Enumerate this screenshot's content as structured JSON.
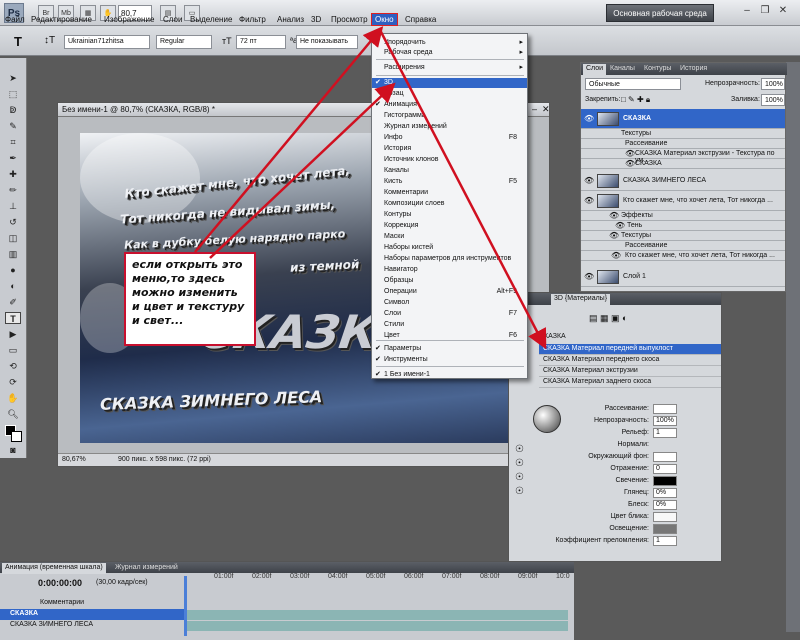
{
  "app": {
    "logo": "Ps",
    "zoom": "80,7",
    "workspace": "Основная рабочая среда"
  },
  "menu": [
    "Файл",
    "Редактирование",
    "Изображение",
    "Слои",
    "Выделение",
    "Фильтр",
    "Анализ",
    "3D",
    "Просмотр",
    "Окно",
    "Справка"
  ],
  "options": {
    "font": "Ukrainian71zhitsa",
    "style": "Regular",
    "size": "72 пт",
    "aa": "Не показывать"
  },
  "document": {
    "title": "Без имени-1 @ 80,7% (СКАЗКА, RGB/8) *",
    "zoom": "80,67%",
    "info": "900 пикс. x 598 пикс. (72 ppi)",
    "line1": "Кто скажет мне, что хочет лета,",
    "line2": "Тот никогда не видывал зимы,",
    "line3": "Как в дубку белую нарядно парко",
    "line4": "из темной",
    "title_word": "СКАЗКА",
    "bottom_word": "СКАЗКА ЗИМНЕГО ЛЕСА"
  },
  "callout": "если открыть это меню,то здесь можно изменить и цвет и текстуру и свет...",
  "window_menu": {
    "items": [
      {
        "label": "Упорядочить",
        "arrow": "▸"
      },
      {
        "label": "Рабочая среда",
        "arrow": "▸"
      },
      {
        "label": "Расширения",
        "arrow": "▸"
      },
      {
        "label": "3D",
        "check": "✔",
        "selected": true
      },
      {
        "label": "Абзац"
      },
      {
        "label": "Анимация",
        "check": "✔"
      },
      {
        "label": "Гистограмма"
      },
      {
        "label": "Журнал измерений"
      },
      {
        "label": "Инфо",
        "shortcut": "F8"
      },
      {
        "label": "История"
      },
      {
        "label": "Источник клонов"
      },
      {
        "label": "Каналы"
      },
      {
        "label": "Кисть",
        "shortcut": "F5"
      },
      {
        "label": "Комментарии"
      },
      {
        "label": "Композиции слоев"
      },
      {
        "label": "Контуры"
      },
      {
        "label": "Коррекция"
      },
      {
        "label": "Маски"
      },
      {
        "label": "Наборы кистей"
      },
      {
        "label": "Наборы параметров для инструментов"
      },
      {
        "label": "Навигатор"
      },
      {
        "label": "Образцы"
      },
      {
        "label": "Операции",
        "shortcut": "Alt+F9"
      },
      {
        "label": "Символ"
      },
      {
        "label": "Слои",
        "shortcut": "F7"
      },
      {
        "label": "Стили"
      },
      {
        "label": "Цвет",
        "shortcut": "F6"
      },
      {
        "label": "Параметры",
        "check": "✔"
      },
      {
        "label": "Инструменты",
        "check": "✔"
      },
      {
        "label": "1 Без имени-1",
        "check": "✔"
      }
    ]
  },
  "layers_panel": {
    "tabs": [
      "Слои",
      "Каналы",
      "Контуры",
      "История"
    ],
    "blend": "Обычные",
    "opacity_label": "Непрозрачность:",
    "opacity": "100%",
    "lock_label": "Закрепить:",
    "fill_label": "Заливка:",
    "fill": "100%",
    "rows": [
      "СКАЗКА",
      "Текстуры",
      "Рассеивание",
      "СКАЗКА Материал экструзии - Текстура по ум...",
      "СКАЗКА",
      "СКАЗКА ЗИМНЕГО ЛЕСА",
      "Кто скажет мне, что хочет лета,  Тот никогда ...",
      "Эффекты",
      "Тень",
      "Текстуры",
      "Рассеивание",
      "Кто скажет мне, что хочет лета,  Тот никогда ...",
      "Слой 1"
    ]
  },
  "panel3d": {
    "title": "3D {Материалы}",
    "tree_root": "СКАЗКА",
    "materials": [
      "СКАЗКА Материал передней выпуклост",
      "СКАЗКА Материал переднего скоса",
      "СКАЗКА Материал экструзии",
      "СКАЗКА Материал заднего скоса"
    ],
    "props": [
      {
        "label": "Рассеивание:",
        "value": ""
      },
      {
        "label": "Непрозрачность:",
        "value": "100%"
      },
      {
        "label": "Рельеф:",
        "value": "1"
      },
      {
        "label": "Нормали:",
        "value": ""
      },
      {
        "label": "Окружающий фон:",
        "value": ""
      },
      {
        "label": "Отражение:",
        "value": "0"
      },
      {
        "label": "Свечение:",
        "value": ""
      },
      {
        "label": "Глянец:",
        "value": "0%"
      },
      {
        "label": "Блеск:",
        "value": "0%"
      },
      {
        "label": "Цвет блика:",
        "value": ""
      },
      {
        "label": "Освещение:",
        "value": ""
      },
      {
        "label": "Коэффициент преломления:",
        "value": "1"
      }
    ]
  },
  "timeline": {
    "tabs": [
      "Анимация (временная шкала)",
      "Журнал измерений"
    ],
    "time": "0:00:00:00",
    "fps": "(30,00 кадр/сек)",
    "marks": [
      "01:00f",
      "02:00f",
      "03:00f",
      "04:00f",
      "05:00f",
      "06:00f",
      "07:00f",
      "08:00f",
      "09:00f",
      "10:0"
    ],
    "rows": [
      "Комментарии",
      "СКАЗКА",
      "СКАЗКА ЗИМНЕГО ЛЕСА"
    ]
  },
  "colors": {
    "accent": "#3166c8",
    "arrow": "#d01020"
  }
}
